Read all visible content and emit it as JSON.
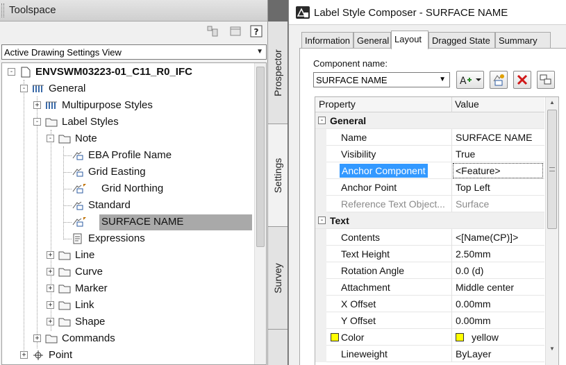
{
  "toolspace": {
    "title": "Toolspace",
    "view_select": "Active Drawing Settings View",
    "tabs": [
      "Prospector",
      "Settings",
      "Survey"
    ],
    "tree": [
      {
        "label": "ENVSWM03223-01_C11_R0_IFC",
        "expander": "-"
      },
      {
        "label": "General",
        "expander": "-"
      },
      {
        "label": "Multipurpose Styles",
        "expander": "+"
      },
      {
        "label": "Label Styles",
        "expander": "-"
      },
      {
        "label": "Note",
        "expander": "-"
      },
      {
        "label": "EBA Profile Name"
      },
      {
        "label": "Grid Easting"
      },
      {
        "label": "Grid Northing"
      },
      {
        "label": "Standard"
      },
      {
        "label": "SURFACE NAME"
      },
      {
        "label": "Expressions"
      },
      {
        "label": "Line",
        "expander": "+"
      },
      {
        "label": "Curve",
        "expander": "+"
      },
      {
        "label": "Marker",
        "expander": "+"
      },
      {
        "label": "Link",
        "expander": "+"
      },
      {
        "label": "Shape",
        "expander": "+"
      },
      {
        "label": "Commands",
        "expander": "+"
      },
      {
        "label": "Point",
        "expander": "+"
      }
    ]
  },
  "composer": {
    "title": "Label Style Composer - SURFACE NAME",
    "tabs": [
      "Information",
      "General",
      "Layout",
      "Dragged State",
      "Summary"
    ],
    "active_tab": "Layout",
    "component_label": "Component name:",
    "component_value": "SURFACE NAME",
    "grid_headers": {
      "property": "Property",
      "value": "Value"
    },
    "categories": {
      "general": "General",
      "text": "Text"
    },
    "rows": [
      {
        "name": "Name",
        "value": "SURFACE NAME"
      },
      {
        "name": "Visibility",
        "value": "True"
      },
      {
        "name": "Anchor Component",
        "value": "<Feature>"
      },
      {
        "name": "Anchor Point",
        "value": "Top Left"
      },
      {
        "name": "Reference Text Object...",
        "value": "Surface"
      },
      {
        "name": "Contents",
        "value": "<[Name(CP)]>"
      },
      {
        "name": "Text Height",
        "value": "2.50mm"
      },
      {
        "name": "Rotation Angle",
        "value": "0.0 (d)"
      },
      {
        "name": "Attachment",
        "value": "Middle center"
      },
      {
        "name": "X Offset",
        "value": "0.00mm"
      },
      {
        "name": "Y Offset",
        "value": "0.00mm"
      },
      {
        "name": "Color",
        "value": "yellow"
      },
      {
        "name": "Lineweight",
        "value": "ByLayer"
      }
    ],
    "colors": {
      "highlight": "#3399ff",
      "swatch": "#ffff00",
      "selection": "#a9a9a9"
    }
  }
}
